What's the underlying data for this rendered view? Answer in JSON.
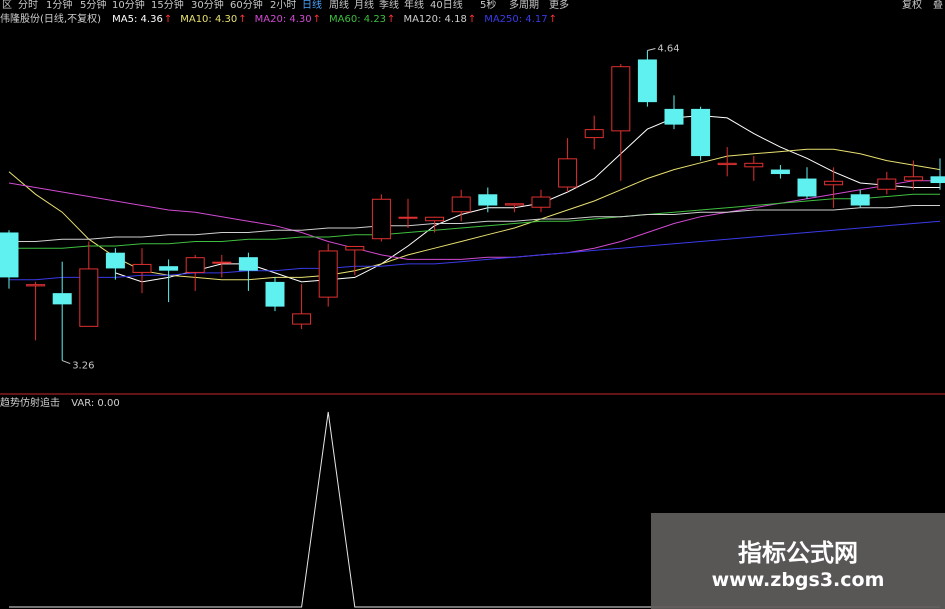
{
  "toolbar": {
    "items": [
      {
        "label": "区",
        "x": 2
      },
      {
        "label": "分时",
        "x": 18
      },
      {
        "label": "1分钟",
        "x": 46
      },
      {
        "label": "5分钟",
        "x": 80
      },
      {
        "label": "10分钟",
        "x": 112
      },
      {
        "label": "15分钟",
        "x": 151
      },
      {
        "label": "30分钟",
        "x": 191
      },
      {
        "label": "60分钟",
        "x": 230
      },
      {
        "label": "2小时",
        "x": 270
      },
      {
        "label": "日线",
        "x": 302
      },
      {
        "label": "周线",
        "x": 329
      },
      {
        "label": "月线",
        "x": 354
      },
      {
        "label": "季线",
        "x": 379
      },
      {
        "label": "年线",
        "x": 404
      },
      {
        "label": "40日线",
        "x": 430
      },
      {
        "label": "5秒",
        "x": 480
      },
      {
        "label": "多周期",
        "x": 509
      },
      {
        "label": "更多",
        "x": 549
      },
      {
        "label": "复权",
        "x": 902
      },
      {
        "label": "叠",
        "x": 933
      }
    ],
    "active": "日线"
  },
  "main_legend": {
    "title": "伟隆股份(日线,不复权)",
    "items": [
      {
        "text": "MA5: 4.36",
        "color": "#ffffff",
        "arrow": "↑"
      },
      {
        "text": "MA10: 4.30",
        "color": "#e8e070",
        "arrow": "↑"
      },
      {
        "text": "MA20: 4.30",
        "color": "#d24ad2",
        "arrow": "↑"
      },
      {
        "text": "MA60: 4.23",
        "color": "#3fbf3f",
        "arrow": "↑"
      },
      {
        "text": "MA120: 4.18",
        "color": "#cfcfcf",
        "arrow": "↑"
      },
      {
        "text": "MA250: 4.17",
        "color": "#3a3ae8",
        "arrow": "↑"
      }
    ],
    "arrow_color": "#ff3333"
  },
  "sub_legend": {
    "title": "趋势仿射追击",
    "items": [
      {
        "text": "VAR: 0.00",
        "color": "#cfcfcf"
      }
    ]
  },
  "colors": {
    "up": "#e03030",
    "down": "#5ff0f0",
    "price_label": "#c8c8c8",
    "divider": "#c82828",
    "signal": "#e6e6e6"
  },
  "chart_data": {
    "type": "candlestick",
    "ylim": [
      3.12,
      4.74
    ],
    "max_label": "4.64",
    "min_label": "3.26",
    "candles": [
      {
        "o": 3.83,
        "h": 3.84,
        "l": 3.58,
        "c": 3.63
      },
      {
        "o": 3.59,
        "h": 3.61,
        "l": 3.35,
        "c": 3.6
      },
      {
        "o": 3.56,
        "h": 3.7,
        "l": 3.26,
        "c": 3.51
      },
      {
        "o": 3.41,
        "h": 3.79,
        "l": 3.42,
        "c": 3.67
      },
      {
        "o": 3.74,
        "h": 3.76,
        "l": 3.62,
        "c": 3.67
      },
      {
        "o": 3.65,
        "h": 3.76,
        "l": 3.56,
        "c": 3.69
      },
      {
        "o": 3.68,
        "h": 3.71,
        "l": 3.52,
        "c": 3.66
      },
      {
        "o": 3.65,
        "h": 3.73,
        "l": 3.57,
        "c": 3.72
      },
      {
        "o": 3.7,
        "h": 3.73,
        "l": 3.63,
        "c": 3.7
      },
      {
        "o": 3.72,
        "h": 3.74,
        "l": 3.57,
        "c": 3.66
      },
      {
        "o": 3.61,
        "h": 3.63,
        "l": 3.48,
        "c": 3.5
      },
      {
        "o": 3.42,
        "h": 3.6,
        "l": 3.4,
        "c": 3.47
      },
      {
        "o": 3.54,
        "h": 3.78,
        "l": 3.5,
        "c": 3.75
      },
      {
        "o": 3.75,
        "h": 3.77,
        "l": 3.64,
        "c": 3.77
      },
      {
        "o": 3.8,
        "h": 4.0,
        "l": 3.79,
        "c": 3.98
      },
      {
        "o": 3.9,
        "h": 3.98,
        "l": 3.85,
        "c": 3.9
      },
      {
        "o": 3.88,
        "h": 3.9,
        "l": 3.83,
        "c": 3.9
      },
      {
        "o": 3.92,
        "h": 4.02,
        "l": 3.88,
        "c": 3.99
      },
      {
        "o": 4.0,
        "h": 4.03,
        "l": 3.92,
        "c": 3.95
      },
      {
        "o": 3.95,
        "h": 3.96,
        "l": 3.92,
        "c": 3.96
      },
      {
        "o": 3.94,
        "h": 4.02,
        "l": 3.92,
        "c": 3.99
      },
      {
        "o": 4.03,
        "h": 4.25,
        "l": 4.01,
        "c": 4.16
      },
      {
        "o": 4.25,
        "h": 4.35,
        "l": 4.2,
        "c": 4.29
      },
      {
        "o": 4.28,
        "h": 4.58,
        "l": 4.06,
        "c": 4.57
      },
      {
        "o": 4.6,
        "h": 4.64,
        "l": 4.39,
        "c": 4.41
      },
      {
        "o": 4.38,
        "h": 4.44,
        "l": 4.29,
        "c": 4.31
      },
      {
        "o": 4.38,
        "h": 4.39,
        "l": 4.15,
        "c": 4.17
      },
      {
        "o": 4.13,
        "h": 4.21,
        "l": 4.08,
        "c": 4.14
      },
      {
        "o": 4.12,
        "h": 4.17,
        "l": 4.06,
        "c": 4.14
      },
      {
        "o": 4.11,
        "h": 4.13,
        "l": 4.07,
        "c": 4.09
      },
      {
        "o": 4.07,
        "h": 4.12,
        "l": 3.98,
        "c": 3.99
      },
      {
        "o": 4.04,
        "h": 4.12,
        "l": 3.94,
        "c": 4.06
      },
      {
        "o": 4.0,
        "h": 4.02,
        "l": 3.94,
        "c": 3.95
      },
      {
        "o": 4.02,
        "h": 4.1,
        "l": 4.0,
        "c": 4.07
      },
      {
        "o": 4.06,
        "h": 4.15,
        "l": 4.02,
        "c": 4.08
      },
      {
        "o": 4.08,
        "h": 4.16,
        "l": 4.02,
        "c": 4.05
      }
    ],
    "ma": [
      {
        "name": "MA5",
        "color": "#ffffff",
        "values": [
          null,
          null,
          null,
          null,
          3.65,
          3.61,
          3.63,
          3.66,
          3.69,
          3.69,
          3.65,
          3.61,
          3.62,
          3.63,
          3.69,
          3.77,
          3.86,
          3.91,
          3.94,
          3.94,
          3.96,
          4.01,
          4.07,
          4.18,
          4.29,
          4.34,
          4.35,
          4.34,
          4.27,
          4.21,
          4.16,
          4.1,
          4.05,
          4.04,
          4.03,
          4.03
        ]
      },
      {
        "name": "MA10",
        "color": "#e8e070",
        "values": [
          4.1,
          4.0,
          3.92,
          3.8,
          3.72,
          3.66,
          3.64,
          3.63,
          3.62,
          3.62,
          3.63,
          3.63,
          3.64,
          3.66,
          3.69,
          3.73,
          3.76,
          3.79,
          3.82,
          3.85,
          3.89,
          3.93,
          3.97,
          4.02,
          4.07,
          4.11,
          4.14,
          4.17,
          4.18,
          4.19,
          4.2,
          4.2,
          4.18,
          4.15,
          4.13,
          4.11
        ]
      },
      {
        "name": "MA20",
        "color": "#d24ad2",
        "values": [
          4.05,
          4.03,
          4.01,
          3.99,
          3.97,
          3.95,
          3.93,
          3.92,
          3.9,
          3.88,
          3.86,
          3.83,
          3.79,
          3.76,
          3.73,
          3.71,
          3.71,
          3.71,
          3.72,
          3.72,
          3.73,
          3.74,
          3.76,
          3.79,
          3.83,
          3.87,
          3.9,
          3.92,
          3.94,
          3.96,
          3.98,
          4.0,
          4.02,
          4.04,
          4.06,
          4.06
        ]
      },
      {
        "name": "MA60",
        "color": "#3fbf3f",
        "values": [
          3.76,
          3.76,
          3.76,
          3.77,
          3.77,
          3.78,
          3.78,
          3.79,
          3.79,
          3.8,
          3.8,
          3.81,
          3.81,
          3.82,
          3.82,
          3.83,
          3.84,
          3.85,
          3.86,
          3.87,
          3.88,
          3.88,
          3.89,
          3.9,
          3.91,
          3.92,
          3.93,
          3.94,
          3.95,
          3.96,
          3.97,
          3.98,
          3.98,
          3.99,
          4.0,
          4.0
        ]
      },
      {
        "name": "MA120",
        "color": "#cfcfcf",
        "values": [
          3.79,
          3.79,
          3.8,
          3.8,
          3.81,
          3.81,
          3.82,
          3.82,
          3.83,
          3.83,
          3.84,
          3.84,
          3.85,
          3.85,
          3.86,
          3.86,
          3.87,
          3.87,
          3.88,
          3.88,
          3.89,
          3.89,
          3.9,
          3.9,
          3.91,
          3.91,
          3.92,
          3.92,
          3.93,
          3.93,
          3.93,
          3.93,
          3.94,
          3.94,
          3.95,
          3.95
        ]
      },
      {
        "name": "MA250",
        "color": "#3a3ae8",
        "values": [
          3.62,
          3.62,
          3.63,
          3.63,
          3.63,
          3.64,
          3.64,
          3.65,
          3.65,
          3.66,
          3.66,
          3.67,
          3.67,
          3.68,
          3.68,
          3.69,
          3.69,
          3.7,
          3.71,
          3.72,
          3.73,
          3.74,
          3.75,
          3.76,
          3.77,
          3.78,
          3.79,
          3.8,
          3.81,
          3.82,
          3.83,
          3.84,
          3.85,
          3.86,
          3.87,
          3.88
        ]
      }
    ],
    "indicator": {
      "name": "VAR",
      "ylim": [
        0,
        1
      ],
      "values": [
        0,
        0,
        0,
        0,
        0,
        0,
        0,
        0,
        0,
        0,
        0,
        0,
        1,
        0,
        0,
        0,
        0,
        0,
        0,
        0,
        0,
        0,
        0,
        0,
        0,
        0,
        0,
        0,
        0,
        0,
        0,
        0,
        0,
        0,
        0,
        0
      ]
    }
  },
  "watermark": {
    "title": "指标公式网",
    "url": "www.zbgs3.com"
  }
}
